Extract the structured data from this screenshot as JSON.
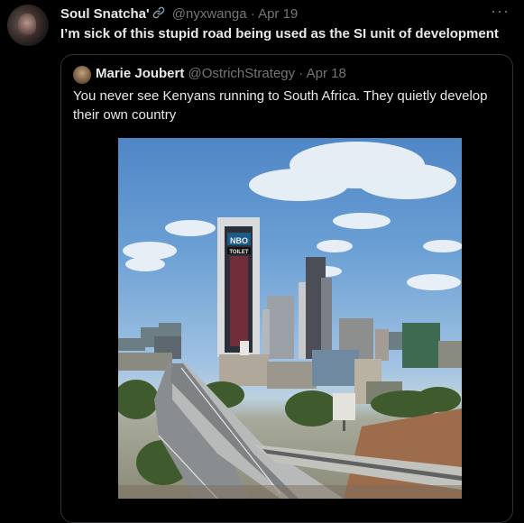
{
  "tweet": {
    "display_name": "Soul Snatcha'",
    "handle": "@nyxwanga",
    "separator": "·",
    "date": "Apr 19",
    "text": "I’m sick of this stupid road being used as the SI unit of development",
    "more_label": "···"
  },
  "quoted": {
    "display_name": "Marie Joubert",
    "handle": "@OstrichStrategy",
    "separator": "·",
    "date": "Apr 18",
    "text": "You never see Kenyans running to South Africa.  They quietly develop their own country",
    "photo_sign_top": "NBO",
    "photo_sign_sub": "TOILET"
  },
  "colors": {
    "background": "#000000",
    "text_primary": "#e7e9ea",
    "text_secondary": "#71767b",
    "border": "#2f3336"
  },
  "icons": [
    "link-icon",
    "more-icon"
  ]
}
